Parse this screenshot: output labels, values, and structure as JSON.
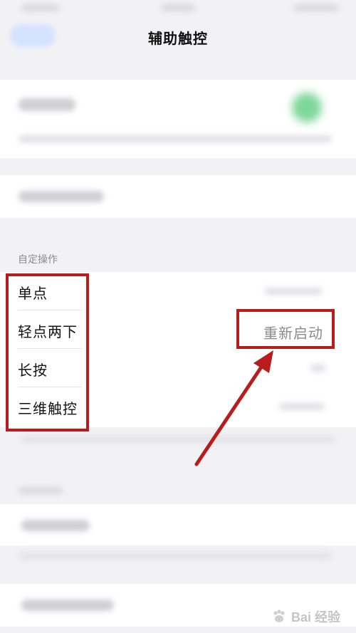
{
  "header": {
    "title": "辅助触控"
  },
  "sections": {
    "custom_actions_header": "自定操作"
  },
  "custom_actions": [
    {
      "label": "单点"
    },
    {
      "label": "轻点两下"
    },
    {
      "label": "长按"
    },
    {
      "label": "三维触控"
    }
  ],
  "overlay": {
    "restart_label": "重新启动"
  },
  "watermark": {
    "text": "Bai 经验"
  },
  "colors": {
    "annotation_red": "#b81c1c",
    "toggle_green": "#7ed79a",
    "background": "#f2f2f5"
  }
}
